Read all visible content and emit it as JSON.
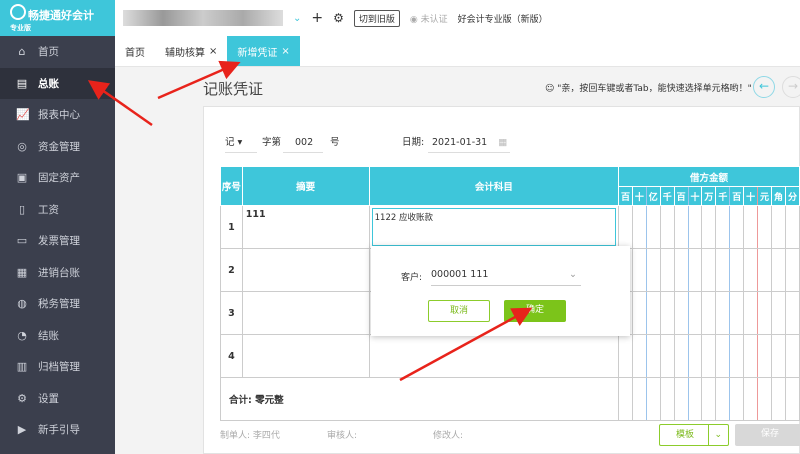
{
  "app": {
    "name": "畅捷通好会计",
    "edition": "专业版"
  },
  "sidebar": {
    "items": [
      {
        "label": "首页",
        "icon": "home-icon"
      },
      {
        "label": "总账",
        "icon": "ledger-icon",
        "active": true
      },
      {
        "label": "报表中心",
        "icon": "chart-icon"
      },
      {
        "label": "资金管理",
        "icon": "money-icon"
      },
      {
        "label": "固定资产",
        "icon": "asset-icon"
      },
      {
        "label": "工资",
        "icon": "salary-icon"
      },
      {
        "label": "发票管理",
        "icon": "invoice-icon"
      },
      {
        "label": "进销台账",
        "icon": "inventory-icon"
      },
      {
        "label": "税务管理",
        "icon": "tax-icon"
      },
      {
        "label": "结账",
        "icon": "close-books-icon"
      },
      {
        "label": "归档管理",
        "icon": "archive-icon"
      },
      {
        "label": "设置",
        "icon": "gear-icon"
      },
      {
        "label": "新手引导",
        "icon": "guide-icon"
      }
    ]
  },
  "header": {
    "switch_old": "切到旧版",
    "auth": "未认证",
    "product": "好会计专业版（新版）"
  },
  "tabs": [
    {
      "label": "首页"
    },
    {
      "label": "辅助核算"
    },
    {
      "label": "新增凭证"
    }
  ],
  "page": {
    "title": "记账凭证",
    "tip": "\"亲，按回车键或者Tab，能快速选择单元格哟！\""
  },
  "voucher": {
    "word": "记",
    "zi_label": "字第",
    "number": "002",
    "hao": "号",
    "date_label": "日期:",
    "date": "2021-01-31"
  },
  "table": {
    "headers": {
      "seq": "序号",
      "summary": "摘要",
      "account": "会计科目",
      "debit": "借方金额"
    },
    "units": [
      "百",
      "十",
      "亿",
      "千",
      "百",
      "十",
      "万",
      "千",
      "百",
      "十",
      "元",
      "角",
      "分"
    ],
    "rows": [
      {
        "seq": "1",
        "summary": "111",
        "account": "1122  应收账款"
      },
      {
        "seq": "2"
      },
      {
        "seq": "3"
      },
      {
        "seq": "4"
      }
    ],
    "total_label": "合计:",
    "total_value": "零元整"
  },
  "popup": {
    "customer_label": "客户:",
    "customer_value": "000001  111",
    "cancel": "取消",
    "confirm": "确定"
  },
  "footer": {
    "maker": "制单人: 李四代",
    "reviewer": "审核人:",
    "modifier": "修改人:",
    "template": "模板",
    "save": "保存"
  }
}
